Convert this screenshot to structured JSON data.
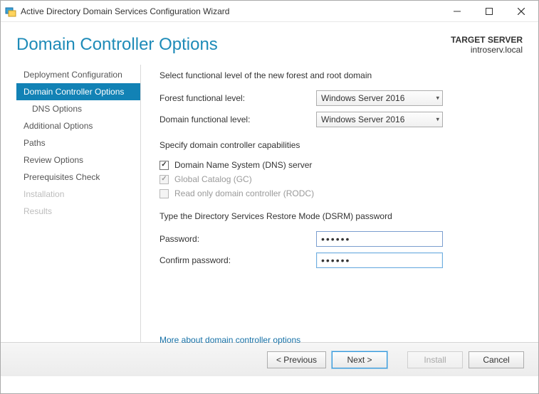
{
  "window": {
    "title": "Active Directory Domain Services Configuration Wizard"
  },
  "header": {
    "page_title": "Domain Controller Options",
    "target_label": "TARGET SERVER",
    "target_value": "introserv.local"
  },
  "sidebar": {
    "items": [
      {
        "label": "Deployment Configuration",
        "level": "top",
        "state": "normal"
      },
      {
        "label": "Domain Controller Options",
        "level": "top",
        "state": "selected"
      },
      {
        "label": "DNS Options",
        "level": "sub",
        "state": "normal"
      },
      {
        "label": "Additional Options",
        "level": "top",
        "state": "normal"
      },
      {
        "label": "Paths",
        "level": "top",
        "state": "normal"
      },
      {
        "label": "Review Options",
        "level": "top",
        "state": "normal"
      },
      {
        "label": "Prerequisites Check",
        "level": "top",
        "state": "normal"
      },
      {
        "label": "Installation",
        "level": "top",
        "state": "disabled"
      },
      {
        "label": "Results",
        "level": "top",
        "state": "disabled"
      }
    ]
  },
  "content": {
    "func_level_text": "Select functional level of the new forest and root domain",
    "forest_label": "Forest functional level:",
    "forest_value": "Windows Server 2016",
    "domain_label": "Domain functional level:",
    "domain_value": "Windows Server 2016",
    "capabilities_text": "Specify domain controller capabilities",
    "dns_label": "Domain Name System (DNS) server",
    "dns_checked": true,
    "gc_label": "Global Catalog (GC)",
    "gc_checked": true,
    "rodc_label": "Read only domain controller (RODC)",
    "rodc_checked": false,
    "dsrm_text": "Type the Directory Services Restore Mode (DSRM) password",
    "password_label": "Password:",
    "password_value": "••••••",
    "confirm_label": "Confirm password:",
    "confirm_value": "••••••",
    "more_link": "More about domain controller options"
  },
  "footer": {
    "previous": "< Previous",
    "next": "Next >",
    "install": "Install",
    "cancel": "Cancel"
  }
}
